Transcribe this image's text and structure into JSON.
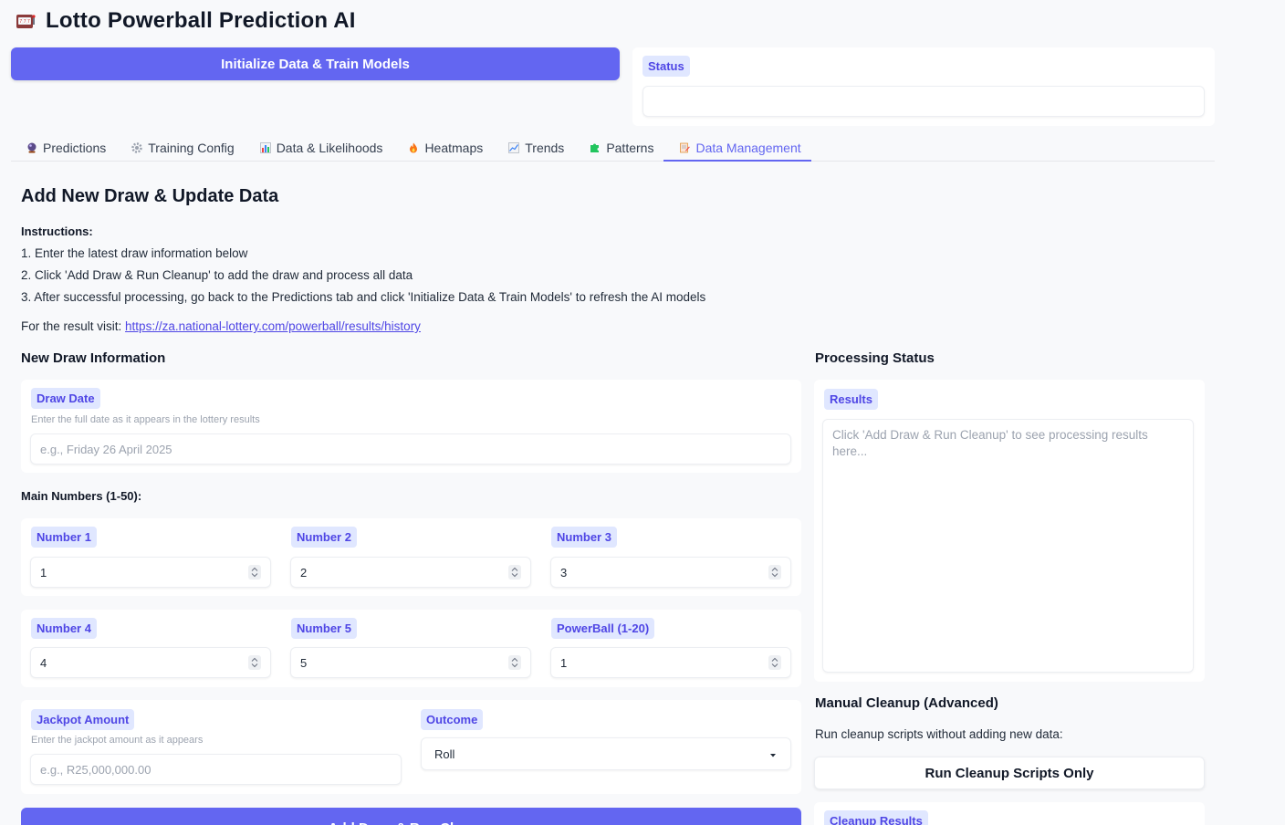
{
  "app": {
    "title": "Lotto Powerball Prediction AI",
    "icon": "slot-machine-icon"
  },
  "init_button": {
    "label": "Initialize Data & Train Models"
  },
  "status": {
    "label": "Status",
    "value": ""
  },
  "tabs": [
    {
      "label": "Predictions",
      "icon": "crystal-ball-icon",
      "active": false
    },
    {
      "label": "Training Config",
      "icon": "gear-icon",
      "active": false
    },
    {
      "label": "Data & Likelihoods",
      "icon": "bar-chart-icon",
      "active": false
    },
    {
      "label": "Heatmaps",
      "icon": "fire-icon",
      "active": false
    },
    {
      "label": "Trends",
      "icon": "trend-chart-icon",
      "active": false
    },
    {
      "label": "Patterns",
      "icon": "puzzle-icon",
      "active": false
    },
    {
      "label": "Data Management",
      "icon": "memo-icon",
      "active": true
    }
  ],
  "section": {
    "title": "Add New Draw & Update Data",
    "instructions_label": "Instructions:",
    "instructions": [
      "1. Enter the latest draw information below",
      "2. Click 'Add Draw & Run Cleanup' to add the draw and process all data",
      "3. After successful processing, go back to the Predictions tab and click 'Initialize Data & Train Models' to refresh the AI models"
    ],
    "result_prefix": "For the result visit:",
    "result_link": "https://za.national-lottery.com/powerball/results/history"
  },
  "new_draw": {
    "heading": "New Draw Information",
    "draw_date": {
      "label": "Draw Date",
      "hint": "Enter the full date as it appears in the lottery results",
      "placeholder": "e.g., Friday 26 April 2025",
      "value": ""
    },
    "main_numbers_label": "Main Numbers (1-50):",
    "numbers": [
      {
        "label": "Number 1",
        "value": "1"
      },
      {
        "label": "Number 2",
        "value": "2"
      },
      {
        "label": "Number 3",
        "value": "3"
      },
      {
        "label": "Number 4",
        "value": "4"
      },
      {
        "label": "Number 5",
        "value": "5"
      },
      {
        "label": "PowerBall (1-20)",
        "value": "1"
      }
    ],
    "jackpot": {
      "label": "Jackpot Amount",
      "hint": "Enter the jackpot amount as it appears",
      "placeholder": "e.g., R25,000,000.00",
      "value": ""
    },
    "outcome": {
      "label": "Outcome",
      "selected": "Roll"
    },
    "add_button": "Add Draw & Run Cleanup"
  },
  "processing": {
    "heading": "Processing Status",
    "results_label": "Results",
    "results_placeholder": "Click 'Add Draw & Run Cleanup' to see processing results here...",
    "manual_heading": "Manual Cleanup (Advanced)",
    "manual_desc": "Run cleanup scripts without adding new data:",
    "cleanup_button": "Run Cleanup Scripts Only",
    "cleanup_results_label": "Cleanup Results"
  },
  "colors": {
    "accent": "#6366f1",
    "chip_bg": "#e0e7ff",
    "chip_text": "#4f46e5"
  }
}
